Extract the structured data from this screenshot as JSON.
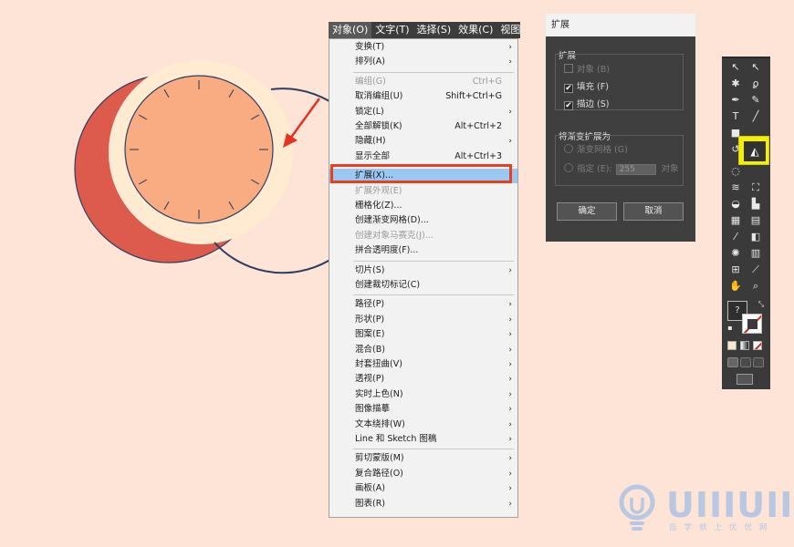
{
  "menubar": [
    "对象(O)",
    "文字(T)",
    "选择(S)",
    "效果(C)",
    "视图(V"
  ],
  "menu": [
    {
      "label": "变换(T)",
      "shortcut": "",
      "arrow": true,
      "disabled": false
    },
    {
      "label": "排列(A)",
      "shortcut": "",
      "arrow": true,
      "disabled": false
    },
    {
      "sep": true
    },
    {
      "label": "编组(G)",
      "shortcut": "Ctrl+G",
      "arrow": false,
      "disabled": true
    },
    {
      "label": "取消编组(U)",
      "shortcut": "Shift+Ctrl+G",
      "arrow": false,
      "disabled": false
    },
    {
      "label": "锁定(L)",
      "shortcut": "",
      "arrow": true,
      "disabled": false
    },
    {
      "label": "全部解锁(K)",
      "shortcut": "Alt+Ctrl+2",
      "arrow": false,
      "disabled": false
    },
    {
      "label": "隐藏(H)",
      "shortcut": "",
      "arrow": true,
      "disabled": false
    },
    {
      "label": "显示全部",
      "shortcut": "Alt+Ctrl+3",
      "arrow": false,
      "disabled": false
    },
    {
      "sep": true
    },
    {
      "label": "扩展(X)...",
      "shortcut": "",
      "arrow": false,
      "disabled": false,
      "highlight": true
    },
    {
      "label": "扩展外观(E)",
      "shortcut": "",
      "arrow": false,
      "disabled": true
    },
    {
      "label": "栅格化(Z)...",
      "shortcut": "",
      "arrow": false,
      "disabled": false
    },
    {
      "label": "创建渐变网格(D)...",
      "shortcut": "",
      "arrow": false,
      "disabled": false
    },
    {
      "label": "创建对象马赛克(J)...",
      "shortcut": "",
      "arrow": false,
      "disabled": true
    },
    {
      "label": "拼合透明度(F)...",
      "shortcut": "",
      "arrow": false,
      "disabled": false
    },
    {
      "sep": true
    },
    {
      "label": "切片(S)",
      "shortcut": "",
      "arrow": true,
      "disabled": false
    },
    {
      "label": "创建裁切标记(C)",
      "shortcut": "",
      "arrow": false,
      "disabled": false
    },
    {
      "sep": true
    },
    {
      "label": "路径(P)",
      "shortcut": "",
      "arrow": true,
      "disabled": false
    },
    {
      "label": "形状(P)",
      "shortcut": "",
      "arrow": true,
      "disabled": false
    },
    {
      "label": "图案(E)",
      "shortcut": "",
      "arrow": true,
      "disabled": false
    },
    {
      "label": "混合(B)",
      "shortcut": "",
      "arrow": true,
      "disabled": false
    },
    {
      "label": "封套扭曲(V)",
      "shortcut": "",
      "arrow": true,
      "disabled": false
    },
    {
      "label": "透视(P)",
      "shortcut": "",
      "arrow": true,
      "disabled": false
    },
    {
      "label": "实时上色(N)",
      "shortcut": "",
      "arrow": true,
      "disabled": false
    },
    {
      "label": "图像描摹",
      "shortcut": "",
      "arrow": true,
      "disabled": false
    },
    {
      "label": "文本绕排(W)",
      "shortcut": "",
      "arrow": true,
      "disabled": false
    },
    {
      "label": "Line 和 Sketch 图稿",
      "shortcut": "",
      "arrow": true,
      "disabled": false
    },
    {
      "sep": true
    },
    {
      "label": "剪切蒙版(M)",
      "shortcut": "",
      "arrow": true,
      "disabled": false
    },
    {
      "label": "复合路径(O)",
      "shortcut": "",
      "arrow": true,
      "disabled": false
    },
    {
      "label": "画板(A)",
      "shortcut": "",
      "arrow": true,
      "disabled": false
    },
    {
      "label": "图表(R)",
      "shortcut": "",
      "arrow": true,
      "disabled": false
    }
  ],
  "dialog": {
    "title": "扩展",
    "group1_label": "扩展",
    "opt_object": "对象 (B)",
    "opt_fill": "填充 (F)",
    "opt_stroke": "描边 (S)",
    "fill_checked": true,
    "stroke_checked": true,
    "object_checked": false,
    "group2_label": "将渐变扩展为",
    "opt_mesh": "渐变网格 (G)",
    "opt_specify": "指定 (E):",
    "specify_value": "255",
    "specify_unit": "对象",
    "ok_label": "确定",
    "cancel_label": "取消"
  },
  "watermark": {
    "text": "UIIIUIII",
    "sub": "自学就上优优网"
  },
  "colors": {
    "background": "#fde4d6",
    "shadow_circle": "#dc5b4c",
    "outer_ring": "#feebd2",
    "face": "#f9ab82",
    "outline": "#2c3e63",
    "highlight_box": "#e8401c",
    "tool_highlight": "#f4f000"
  }
}
